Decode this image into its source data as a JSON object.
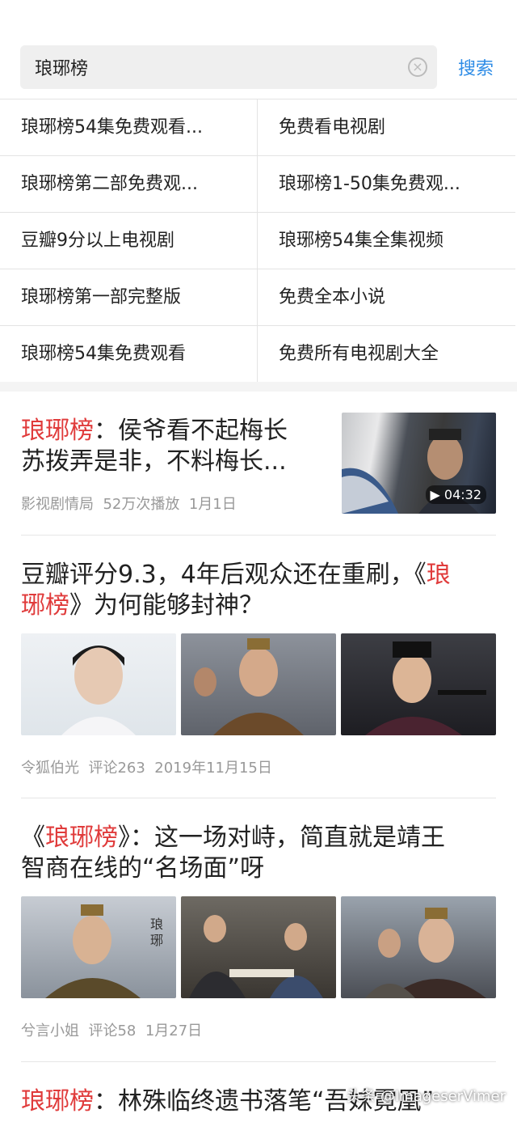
{
  "search": {
    "query": "琅琊榜",
    "button_label": "搜索"
  },
  "suggestions": [
    [
      "琅琊榜54集免费观看...",
      "免费看电视剧"
    ],
    [
      "琅琊榜第二部免费观...",
      "琅琊榜1-50集免费观..."
    ],
    [
      "豆瓣9分以上电视剧",
      "琅琊榜54集全集视频"
    ],
    [
      "琅琊榜第一部完整版",
      "免费全本小说"
    ],
    [
      "琅琊榜54集免费观看",
      "免费所有电视剧大全"
    ]
  ],
  "articles": [
    {
      "title_hl": "琅琊榜",
      "title_rest_1": "：侯爷看不起梅长",
      "title_line2": "苏拨弄是非，不料梅长...",
      "source": "影视剧情局",
      "plays": "52万次播放",
      "date": "1月1日",
      "duration": "▶ 04:32"
    },
    {
      "title_pre": "豆瓣评分9.3，4年后观众还在重刷，《",
      "title_hl_a": "琅",
      "title_hl_b": "琊榜",
      "title_post": "》为何能够封神？",
      "source": "令狐伯光",
      "comments": "评论263",
      "date": "2019年11月15日"
    },
    {
      "title_pre": "《",
      "title_hl": "琅琊榜",
      "title_mid": "》：这一场对峙，简直就是靖王",
      "title_line2": "智商在线的“名场面”呀",
      "source": "兮言小姐",
      "comments": "评论58",
      "date": "1月27日"
    },
    {
      "title_hl": "琅琊榜",
      "title_rest": "：林殊临终遗书落笔“吾妹霓凰”"
    }
  ],
  "watermark": "头条 @ImageserVimer"
}
